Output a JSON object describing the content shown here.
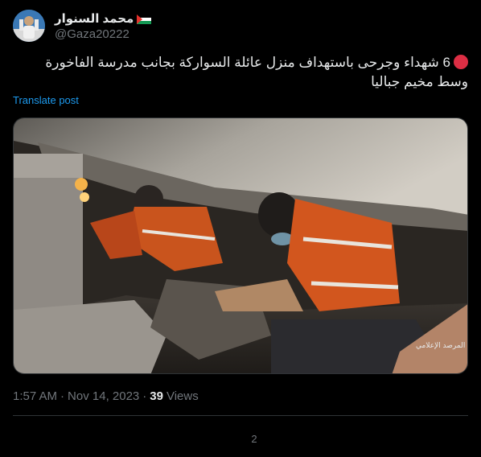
{
  "author": {
    "display_name": "محمد السنوار",
    "handle": "@Gaza20222"
  },
  "post": {
    "text": "6 شهداء وجرحى باستهداف منزل عائلة السواركة بجانب مدرسة الفاخورة وسط مخيم جباليا",
    "translate_label": "Translate post",
    "image_watermark": "المرصد الإعلامي"
  },
  "meta": {
    "time": "1:57 AM",
    "separator": "·",
    "date": "Nov 14, 2023",
    "views_count": "39",
    "views_label": "Views"
  },
  "footer": {
    "reply_count": "2"
  },
  "colors": {
    "background": "#000000",
    "text": "#e7e9ea",
    "muted": "#71767b",
    "link": "#1d9bf0",
    "divider": "#2f3336",
    "red_dot": "#dd2e44"
  },
  "icons": {
    "flag": "palestine-flag-icon",
    "status": "red-circle-icon"
  }
}
